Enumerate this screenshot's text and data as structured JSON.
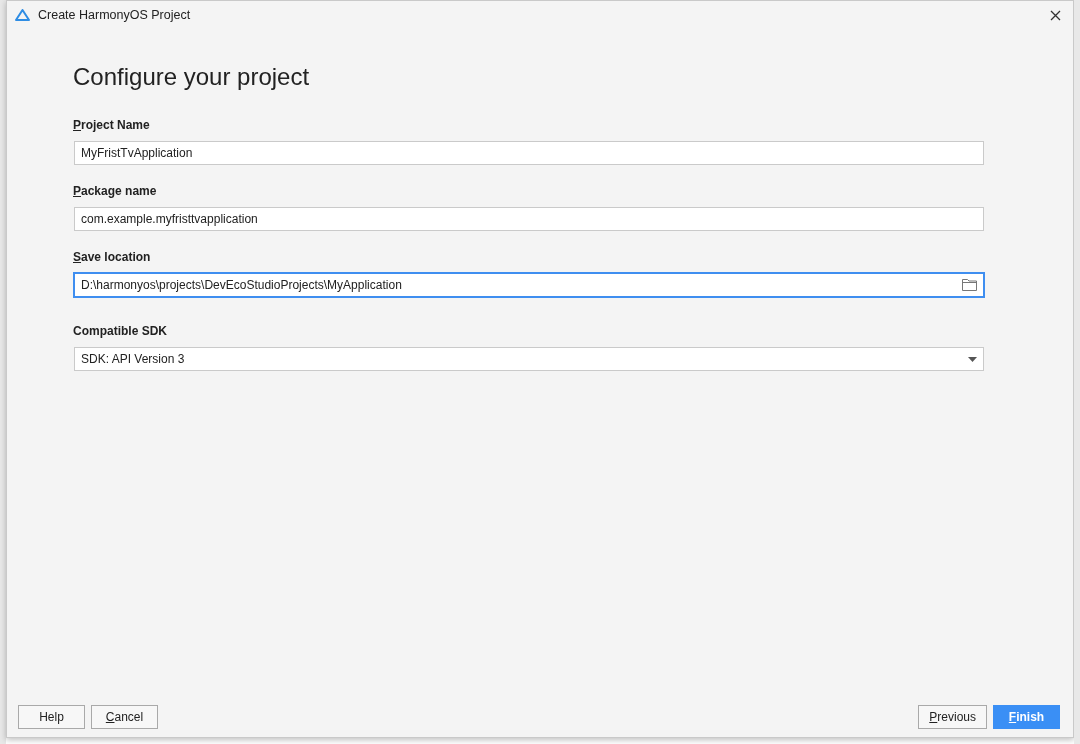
{
  "window": {
    "title": "Create HarmonyOS Project"
  },
  "heading": "Configure your project",
  "fields": [
    {
      "kind": "text",
      "label": "Project Name",
      "mnemonic": true,
      "value": "MyFristTvApplication",
      "focused": false
    },
    {
      "kind": "text",
      "label": "Package name",
      "mnemonic": true,
      "value": "com.example.myfristtvapplication",
      "focused": false
    },
    {
      "kind": "path",
      "label": "Save location",
      "mnemonic": true,
      "value": "D:\\harmonyos\\projects\\DevEcoStudioProjects\\MyApplication",
      "focused": true
    },
    {
      "kind": "dropdown",
      "label": "Compatible SDK",
      "mnemonic": false,
      "value": "SDK: API Version 3",
      "focused": false
    }
  ],
  "buttons_left": [
    {
      "label": "Help",
      "mnemonic": false,
      "primary": false
    },
    {
      "label": "Cancel",
      "mnemonic": true,
      "primary": false
    }
  ],
  "buttons_right": [
    {
      "label": "Previous",
      "mnemonic": true,
      "primary": false
    },
    {
      "label": "Finish",
      "mnemonic": true,
      "primary": true
    }
  ]
}
